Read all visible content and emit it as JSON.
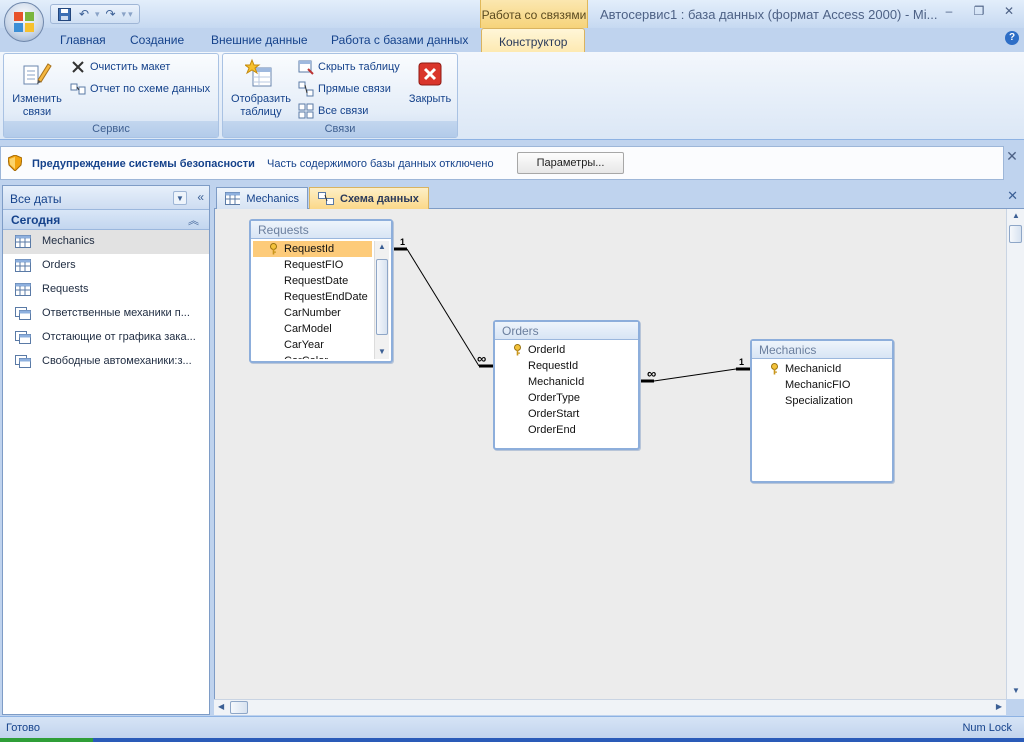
{
  "app": {
    "title": "Автосервис1 : база данных (формат Access 2000) - Mi...",
    "contextual_tab_header": "Работа со связями",
    "minimize": "–",
    "maximize": "❐",
    "close": "✕"
  },
  "ribbon": {
    "tabs": [
      "Главная",
      "Создание",
      "Внешние данные",
      "Работа с базами данных",
      "Конструктор"
    ],
    "active_tab": "Конструктор",
    "groups": {
      "service": {
        "label": "Сервис",
        "edit_relations": "Изменить\nсвязи",
        "clear_layout": "Очистить макет",
        "schema_report": "Отчет по схеме данных"
      },
      "relations": {
        "label": "Связи",
        "show_table": "Отобразить\nтаблицу",
        "hide_table": "Скрыть таблицу",
        "direct_relations": "Прямые связи",
        "all_relations": "Все связи",
        "close": "Закрыть"
      }
    }
  },
  "security_bar": {
    "title": "Предупреждение системы безопасности",
    "message": "Часть содержимого базы данных отключено",
    "button": "Параметры..."
  },
  "nav_pane": {
    "header": "Все даты",
    "group": "Сегодня",
    "items": [
      {
        "label": "Mechanics",
        "type": "table",
        "selected": true
      },
      {
        "label": "Orders",
        "type": "table",
        "selected": false
      },
      {
        "label": "Requests",
        "type": "table",
        "selected": false
      },
      {
        "label": "Ответственные механики п...",
        "type": "query",
        "selected": false
      },
      {
        "label": "Отстающие от графика зака...",
        "type": "query",
        "selected": false
      },
      {
        "label": "Свободные автомеханики:з...",
        "type": "query",
        "selected": false
      }
    ]
  },
  "doc_tabs": [
    {
      "label": "Mechanics",
      "active": false
    },
    {
      "label": "Схема данных",
      "active": true
    }
  ],
  "relationship_tables": [
    {
      "name": "Requests",
      "fields": [
        "RequestId",
        "RequestFIO",
        "RequestDate",
        "RequestEndDate",
        "CarNumber",
        "CarModel",
        "CarYear",
        "CarColor"
      ],
      "key_field": "RequestId",
      "selected_field": "RequestId"
    },
    {
      "name": "Orders",
      "fields": [
        "OrderId",
        "RequestId",
        "MechanicId",
        "OrderType",
        "OrderStart",
        "OrderEnd"
      ],
      "key_field": "OrderId",
      "selected_field": ""
    },
    {
      "name": "Mechanics",
      "fields": [
        "MechanicId",
        "MechanicFIO",
        "Specialization"
      ],
      "key_field": "MechanicId",
      "selected_field": ""
    }
  ],
  "relations": [
    {
      "from_table": "Requests",
      "from_field": "RequestId",
      "from_card": "1",
      "to_table": "Orders",
      "to_field": "RequestId",
      "to_card": "∞"
    },
    {
      "from_table": "Mechanics",
      "from_field": "MechanicId",
      "from_card": "1",
      "to_table": "Orders",
      "to_field": "MechanicId",
      "to_card": "∞"
    }
  ],
  "status": {
    "left": "Готово",
    "right": "Num Lock"
  },
  "colors": {
    "accent": "#15428b",
    "contextual": "#f6d37a",
    "selection": "#fdcb7a"
  }
}
